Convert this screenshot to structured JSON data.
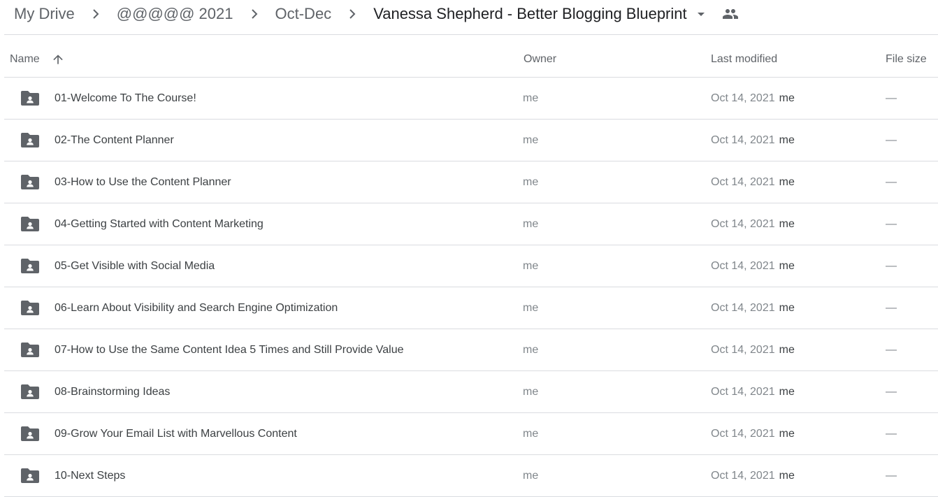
{
  "breadcrumb": {
    "items": [
      "My Drive",
      "@@@@@ 2021",
      "Oct-Dec"
    ],
    "current": "Vanessa Shepherd - Better Blogging Blueprint",
    "chevron_icon": "chevron-right-icon",
    "dropdown_icon": "caret-down-icon",
    "shared_icon": "people-icon"
  },
  "table": {
    "headers": {
      "name": "Name",
      "owner": "Owner",
      "last_modified": "Last modified",
      "file_size": "File size"
    },
    "sort": {
      "column": "name",
      "direction": "ascending",
      "icon": "arrow-up-icon"
    },
    "rows": [
      {
        "name": "01-Welcome To The Course!",
        "owner": "me",
        "date": "Oct 14, 2021",
        "modifier": "me",
        "size": "—"
      },
      {
        "name": "02-The Content Planner",
        "owner": "me",
        "date": "Oct 14, 2021",
        "modifier": "me",
        "size": "—"
      },
      {
        "name": "03-How to Use the Content Planner",
        "owner": "me",
        "date": "Oct 14, 2021",
        "modifier": "me",
        "size": "—"
      },
      {
        "name": "04-Getting Started with Content Marketing",
        "owner": "me",
        "date": "Oct 14, 2021",
        "modifier": "me",
        "size": "—"
      },
      {
        "name": "05-Get Visible with Social Media",
        "owner": "me",
        "date": "Oct 14, 2021",
        "modifier": "me",
        "size": "—"
      },
      {
        "name": "06-Learn About Visibility and Search Engine Optimization",
        "owner": "me",
        "date": "Oct 14, 2021",
        "modifier": "me",
        "size": "—"
      },
      {
        "name": "07-How to Use the Same Content Idea 5 Times and Still Provide Value",
        "owner": "me",
        "date": "Oct 14, 2021",
        "modifier": "me",
        "size": "—"
      },
      {
        "name": "08-Brainstorming Ideas",
        "owner": "me",
        "date": "Oct 14, 2021",
        "modifier": "me",
        "size": "—"
      },
      {
        "name": "09-Grow Your Email List with Marvellous Content",
        "owner": "me",
        "date": "Oct 14, 2021",
        "modifier": "me",
        "size": "—"
      },
      {
        "name": "10-Next Steps",
        "owner": "me",
        "date": "Oct 14, 2021",
        "modifier": "me",
        "size": "—"
      }
    ],
    "row_icon": "shared-folder-icon"
  },
  "colors": {
    "text_primary": "#202124",
    "text_secondary": "#5f6368",
    "divider": "#dadce0",
    "folder_icon": "#5f6368"
  }
}
